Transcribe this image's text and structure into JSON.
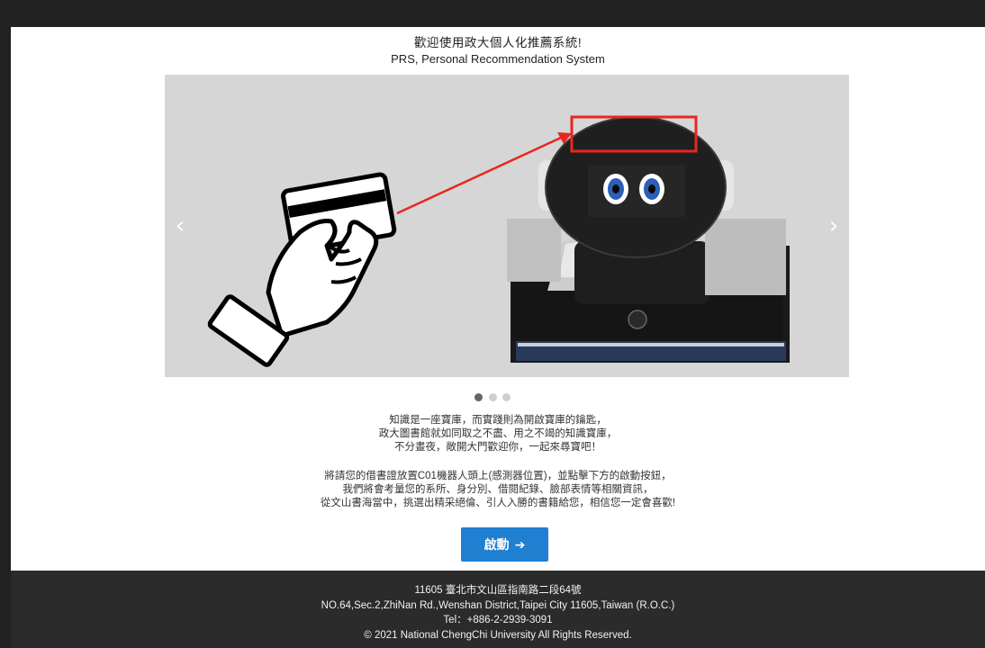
{
  "header": {
    "title_zh": "歡迎使用政大個人化推薦系統!",
    "title_en": "PRS, Personal Recommendation System"
  },
  "carousel": {
    "prev_icon": "‹",
    "next_icon": "›",
    "slide_count": 3,
    "active_index": 0
  },
  "intro": {
    "lines": [
      "知識是一座寶庫，而實踐則為開啟寶庫的鑰匙，",
      "政大圖書館就如同取之不盡、用之不竭的知識寶庫，",
      "不分晝夜，敞開大門歡迎你，一起來尋寶吧！"
    ]
  },
  "instructions": {
    "lines": [
      "將請您的借書證放置C01機器人頭上(感測器位置)，並點擊下方的啟動按鈕，",
      "我們將會考量您的系所、身分別、借閱紀錄、臉部表情等相關資訊，",
      "從文山書海當中，挑選出精采絕倫、引人入勝的書籍給您，相信您一定會喜歡!"
    ]
  },
  "start_button": {
    "label": "啟動",
    "icon": "arrow-right-icon",
    "color": "#1f7fd0"
  },
  "footer": {
    "address_zh": "11605 臺北市文山區指南路二段64號",
    "address_en": "NO.64,Sec.2,ZhiNan Rd.,Wenshan District,Taipei City 11605,Taiwan (R.O.C.)",
    "tel": "Tel：+886-2-2939-3091",
    "copyright": "© 2021 National ChengChi University All Rights Reserved."
  }
}
